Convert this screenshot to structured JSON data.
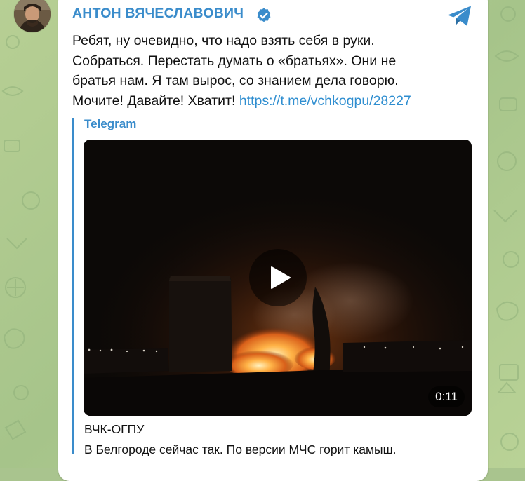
{
  "post": {
    "author": "АНТОН ВЯЧЕСЛАВОВИЧ",
    "text": "Ребят, ну очевидно, что надо взять себя в руки.\nСобраться. Перестать думать о «братьях». Они не\nбратья нам. Я там вырос, со знанием дела говорю.\nМочите! Давайте! Хватит! ",
    "link": "https://t.me/vchkogpu/28227"
  },
  "preview": {
    "site": "Telegram",
    "video_duration": "0:11",
    "title": "ВЧК-ОГПУ",
    "description": "В Белгороде сейчас так. По версии МЧС горит камыш."
  },
  "icons": {
    "verified": "verified-badge-icon",
    "share": "telegram-share-icon",
    "play": "play-icon"
  },
  "colors": {
    "accent": "#3a8ccb",
    "link": "#2f8ed0",
    "wallpaper": "#a9c48e"
  }
}
